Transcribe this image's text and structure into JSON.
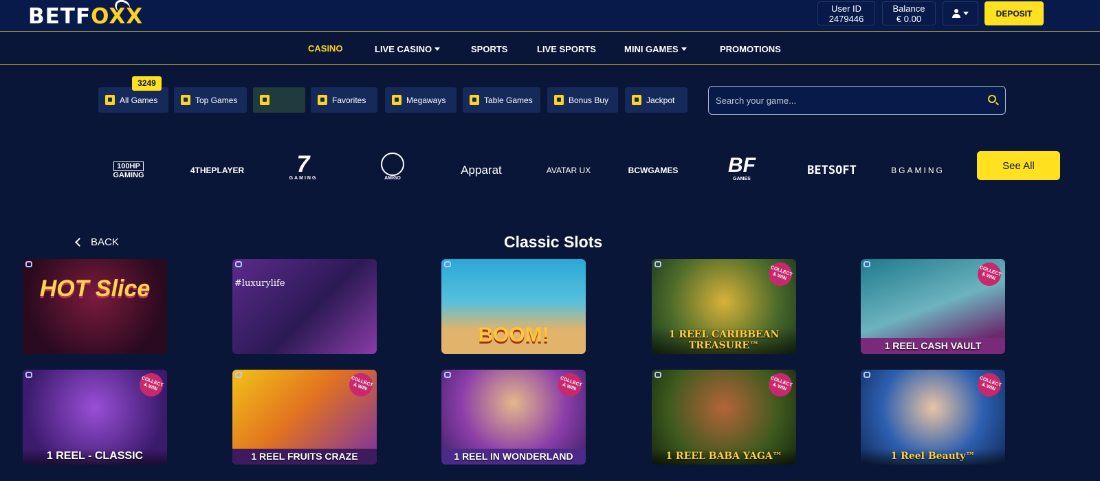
{
  "header": {
    "logo_left": "BETF",
    "logo_o": "O",
    "logo_right": "XX",
    "user_id_label": "User ID",
    "user_id_value": "2479446",
    "balance_label": "Balance",
    "balance_value": "€ 0.00",
    "deposit_label": "DEPOSIT"
  },
  "nav": {
    "casino": "CASINO",
    "live_casino": "LIVE CASINO",
    "sports": "SPORTS",
    "live_sports": "LIVE SPORTS",
    "mini_games": "MINI GAMES",
    "promotions": "PROMOTIONS"
  },
  "categories": {
    "count_badge": "3249",
    "all_games": "All Games",
    "top_games": "Top Games",
    "favorites": "Favorites",
    "megaways": "Megaways",
    "table_games": "Table Games",
    "bonus_buy": "Bonus Buy",
    "jackpot": "Jackpot"
  },
  "search": {
    "placeholder": "Search your game..."
  },
  "providers": {
    "p1_line1": "100HP",
    "p1_line2": "GAMING",
    "p2": "4THEPLAYER",
    "p3_mark": "7",
    "p3_sub": "GAMING",
    "p4": "AMIGO",
    "p5": "Apparat",
    "p6": "AVATAR UX",
    "p7": "BCWGAMES",
    "p8": "BF",
    "p8_sub": "GAMES",
    "p9": "BETSOFT",
    "p10": "BGAMING",
    "see_all": "See All"
  },
  "section": {
    "back_label": "BACK",
    "title": "Classic Slots"
  },
  "games": {
    "g1_art": "HOT Slice",
    "g2_art": "#luxurylife",
    "g3_art": "BOOM!",
    "g4_title": "1 REEL CARIBBEAN TREASURE™",
    "g5_title": "1 REEL CASH VAULT",
    "g6_title": "1 REEL - CLASSIC",
    "g7_title": "1 REEL FRUITS CRAZE",
    "g8_title": "1 REEL IN WONDERLAND",
    "g9_title": "1 REEL BABA YAGA™",
    "g10_title": "1 Reel Beauty™",
    "collect_tag": "COLLECT & WIN"
  },
  "colors": {
    "background": "#0a1638",
    "header": "#071a4a",
    "accent": "#ffe11f",
    "gold_line": "#c9b23a"
  }
}
